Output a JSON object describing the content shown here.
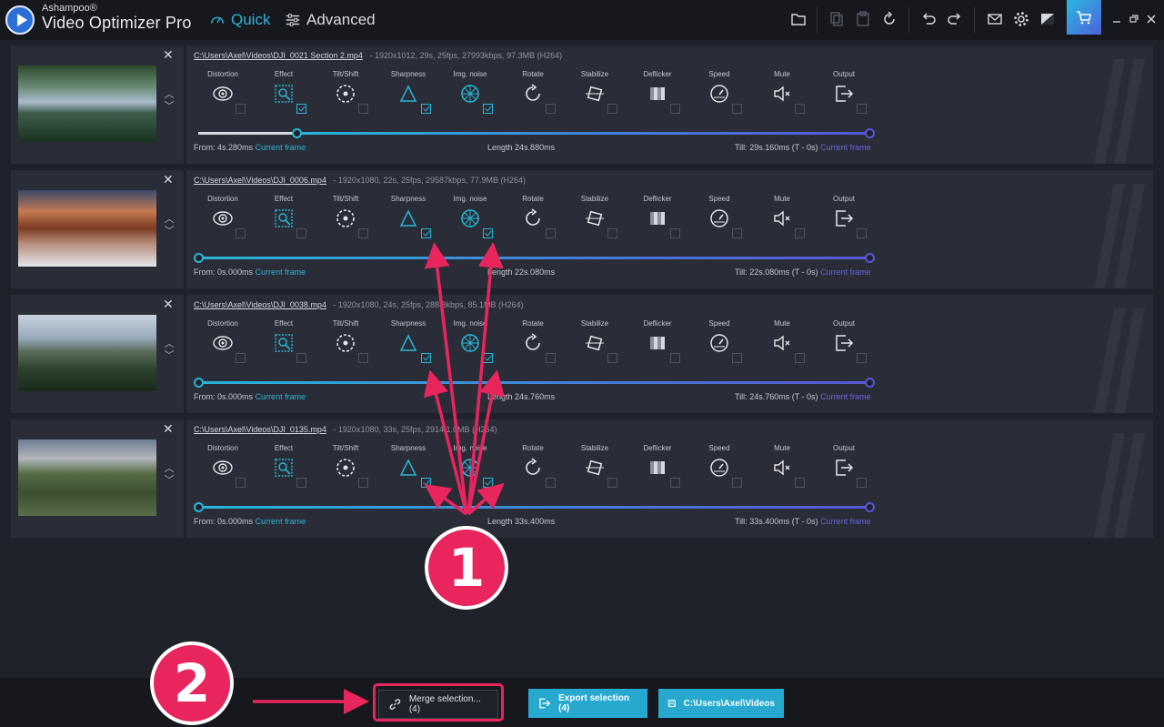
{
  "app": {
    "brand_small": "Ashampoo®",
    "brand_big": "Video Optimizer Pro",
    "modes": [
      "Quick",
      "Advanced"
    ],
    "active_mode": "Quick"
  },
  "toolbar_icons": [
    "folder-icon",
    "copy-icon",
    "paste-icon",
    "reset-icon",
    "undo-icon",
    "redo-icon",
    "mail-icon",
    "settings-icon",
    "theme-icon",
    "cart-icon",
    "minimize-icon",
    "maximize-icon",
    "close-icon"
  ],
  "tool_labels": [
    "Distortion",
    "Effect",
    "Tilt/Shift",
    "Sharpness",
    "Img. noise",
    "Rotate",
    "Stabilize",
    "Deflicker",
    "Speed",
    "Mute",
    "Output"
  ],
  "videos": [
    {
      "path": "C:\\Users\\Axel\\Videos\\DJI_0021 Section 2.mp4",
      "meta": "-   1920x1012, 29s, 25fps, 27993kbps, 97.3MB (H264)",
      "from_label": "From:",
      "from": "4s.280ms",
      "current_frame": "Current frame",
      "length_label": "Length",
      "length": "24s.880ms",
      "till_label": "Till:",
      "till": "29s.160ms (T - 0s)",
      "checks": [
        false,
        true,
        false,
        true,
        true,
        false,
        false,
        false,
        false,
        false,
        false
      ],
      "start_fraction": 0.147,
      "thumb": "lake"
    },
    {
      "path": "C:\\Users\\Axel\\Videos\\DJI_0006.mp4",
      "meta": "-   1920x1080, 22s, 25fps, 29587kbps, 77.9MB (H264)",
      "from_label": "From:",
      "from": "0s.000ms",
      "current_frame": "Current frame",
      "length_label": "Length",
      "length": "22s.080ms",
      "till_label": "Till:",
      "till": "22s.080ms (T - 0s)",
      "checks": [
        false,
        false,
        false,
        true,
        true,
        false,
        false,
        false,
        false,
        false,
        false
      ],
      "start_fraction": 0,
      "thumb": "winter"
    },
    {
      "path": "C:\\Users\\Axel\\Videos\\DJI_0038.mp4",
      "meta": "-   1920x1080, 24s, 25fps, 288.8kbps, 85.1MB (H264)",
      "from_label": "From:",
      "from": "0s.000ms",
      "current_frame": "Current frame",
      "length_label": "Length",
      "length": "24s.760ms",
      "till_label": "Till:",
      "till": "24s.760ms (T - 0s)",
      "checks": [
        false,
        false,
        false,
        true,
        true,
        false,
        false,
        false,
        false,
        false,
        false
      ],
      "start_fraction": 0,
      "thumb": "valley"
    },
    {
      "path": "C:\\Users\\Axel\\Videos\\DJI_0135.mp4",
      "meta": "-   1920x1080, 33s, 25fps, 2914     1.0MB (H264)",
      "from_label": "From:",
      "from": "0s.000ms",
      "current_frame": "Current frame",
      "length_label": "Length",
      "length": "33s.400ms",
      "till_label": "Till:",
      "till": "33s.400ms (T - 0s)",
      "checks": [
        false,
        false,
        false,
        true,
        true,
        false,
        false,
        false,
        false,
        false,
        false
      ],
      "start_fraction": 0,
      "thumb": "park"
    }
  ],
  "bottom": {
    "merge": "Merge selection... (4)",
    "export": "Export selection (4)",
    "folder": "C:\\Users\\Axel\\Videos"
  },
  "annotations": [
    "1",
    "2"
  ],
  "colors": {
    "accent": "#27b6d9",
    "accent_purple": "#5856d6",
    "annotation": "#e8255c"
  }
}
